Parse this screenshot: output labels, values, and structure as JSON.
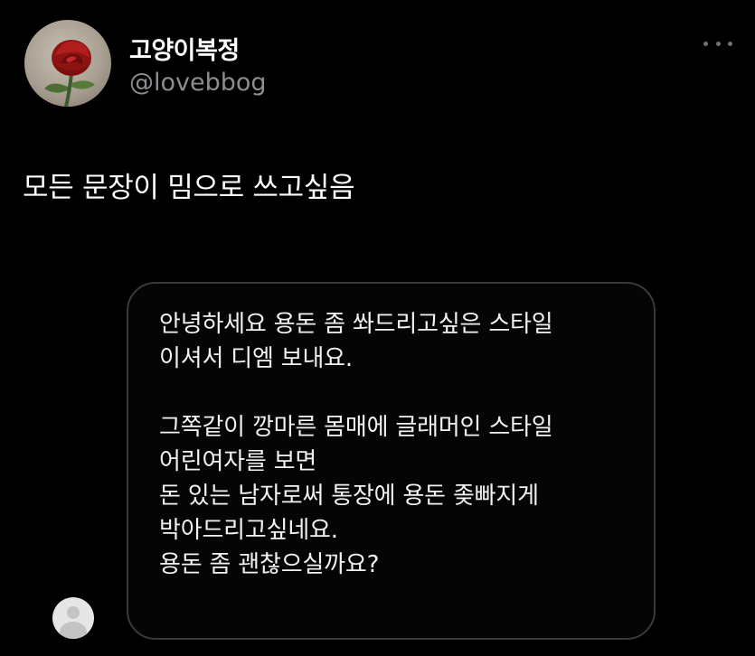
{
  "tweet": {
    "display_name": "고양이복정",
    "handle": "@lovebbog",
    "text": "모든 문장이 밈으로 쓰고싶음",
    "avatar_icon": "rose-avatar-icon",
    "more_icon": "more-options-icon"
  },
  "dm": {
    "lines": [
      "안녕하세요 용돈 좀 쏴드리고싶은 스타일",
      "이셔서 디엠 보내요.",
      "",
      "그쪽같이 깡마른 몸매에 글래머인 스타일",
      "어린여자를 보면",
      "돈 있는 남자로써 통장에 용돈 좆빠지게",
      "박아드리고싶네요.",
      "용돈 좀 괜찮으실까요?"
    ],
    "sender_avatar_icon": "default-avatar-icon"
  },
  "colors": {
    "background": "#000000",
    "text": "#ffffff",
    "handle": "#8a8d91",
    "border": "#3a3a3a"
  }
}
